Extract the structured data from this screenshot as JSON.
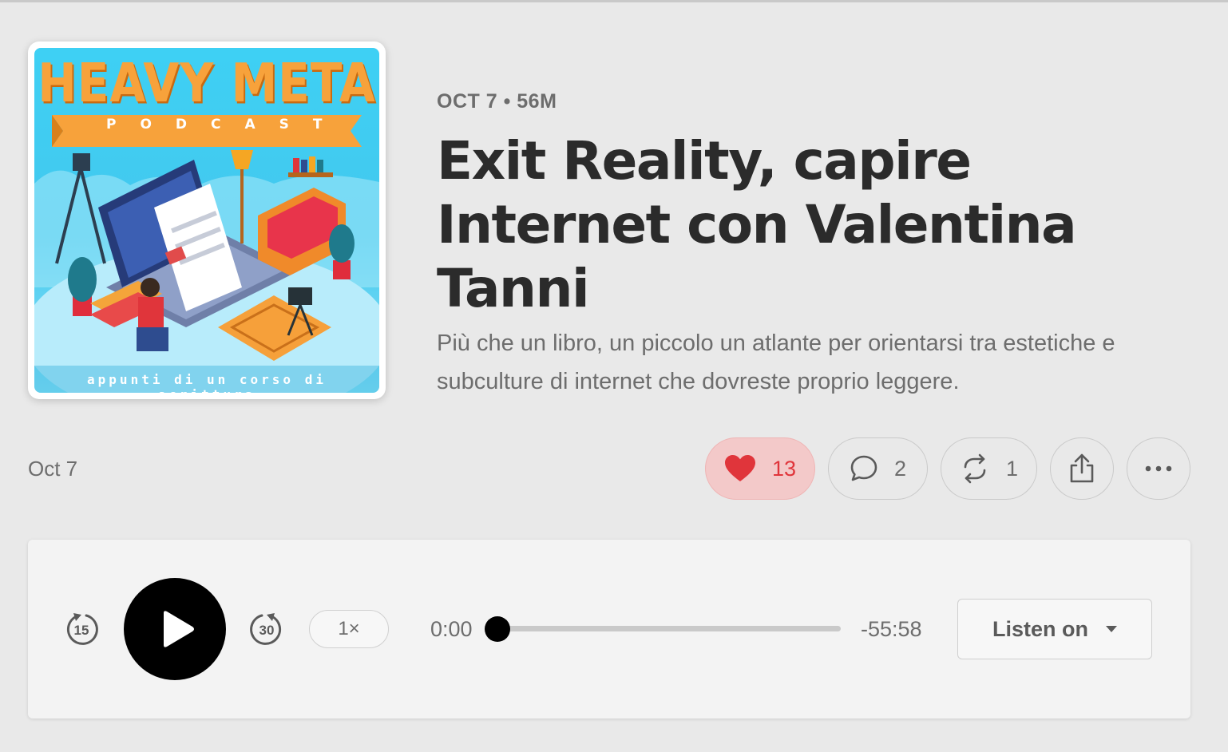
{
  "cover": {
    "title": "HEAVY META",
    "banner": "PODCAST",
    "footer": "appunti di un corso di scrittura"
  },
  "episode": {
    "meta": "OCT 7 • 56M",
    "title": "Exit Reality, capire Internet con Valentina Tanni",
    "subtitle": "Più che un libro, un piccolo un atlante per orientarsi tra estetiche e subculture di internet che dovreste proprio leggere."
  },
  "actions": {
    "date": "Oct 7",
    "likes": "13",
    "comments": "2",
    "restacks": "1"
  },
  "player": {
    "skip_back": "15",
    "skip_forward": "30",
    "speed": "1×",
    "current_time": "0:00",
    "remaining_time": "-55:58",
    "progress": 0,
    "listen_label": "Listen on"
  },
  "colors": {
    "background": "#e9e9e9",
    "like_accent": "#e0353b",
    "like_bg": "#f3c9c9",
    "cover_sky": "#3ed0f4",
    "cover_title": "#f7a23b"
  }
}
